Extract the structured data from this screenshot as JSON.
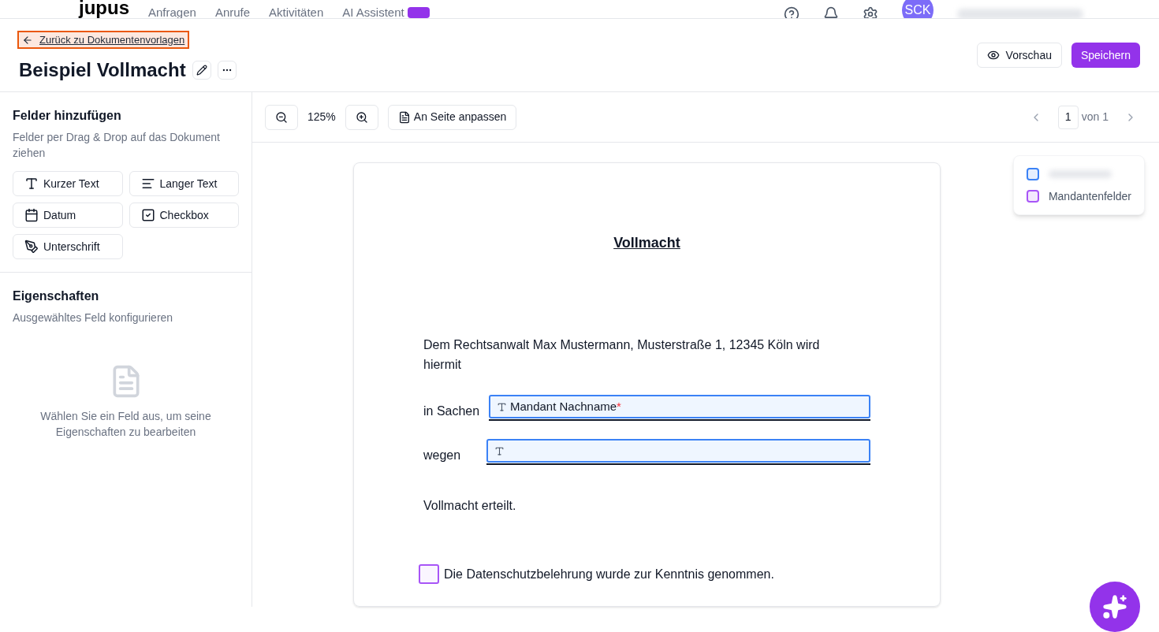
{
  "top_nav": {
    "logo": "jupus",
    "items": [
      {
        "label": "Anfragen"
      },
      {
        "label": "Anrufe"
      },
      {
        "label": "Aktivitäten"
      },
      {
        "label": "AI Assistent",
        "badge": true
      }
    ],
    "avatar": "SCK"
  },
  "header": {
    "back_link": "Zurück zu Dokumentenvorlagen",
    "title": "Beispiel Vollmacht",
    "preview_button": "Vorschau",
    "save_button": "Speichern"
  },
  "sidebar": {
    "fields_title": "Felder hinzufügen",
    "fields_hint": "Felder per Drag & Drop auf das Dokument ziehen",
    "field_types": [
      {
        "kind": "short_text",
        "label": "Kurzer Text"
      },
      {
        "kind": "long_text",
        "label": "Langer Text"
      },
      {
        "kind": "date",
        "label": "Datum"
      },
      {
        "kind": "checkbox",
        "label": "Checkbox"
      },
      {
        "kind": "signature",
        "label": "Unterschrift"
      }
    ],
    "properties_title": "Eigenschaften",
    "properties_hint": "Ausgewähltes Feld konfigurieren",
    "empty_state": "Wählen Sie ein Feld aus, um seine Eigenschaften zu bearbeiten"
  },
  "toolbar": {
    "zoom": "125%",
    "fit_button": "An Seite anpassen",
    "page": "1",
    "page_total": "von 1"
  },
  "legend": [
    {
      "color": "#3b82f6"
    },
    {
      "color": "#a855f7",
      "label": "Mandantenfelder"
    }
  ],
  "document": {
    "title": "Vollmacht",
    "intro": "Dem Rechtsanwalt Max Mustermann, Musterstraße 1, 12345 Köln wird hiermit",
    "field_rows": [
      {
        "label": "in Sachen",
        "field": "Mandant Nachname",
        "required_mark": "*",
        "color": "#3b82f6"
      },
      {
        "label": "wegen",
        "color": "#3b82f6"
      }
    ],
    "closing": "Vollmacht erteilt.",
    "checkbox": {
      "label": "Die Datenschutzbelehrung wurde zur Kenntnis genommen.",
      "checked": false,
      "color": "#a855f7"
    }
  }
}
